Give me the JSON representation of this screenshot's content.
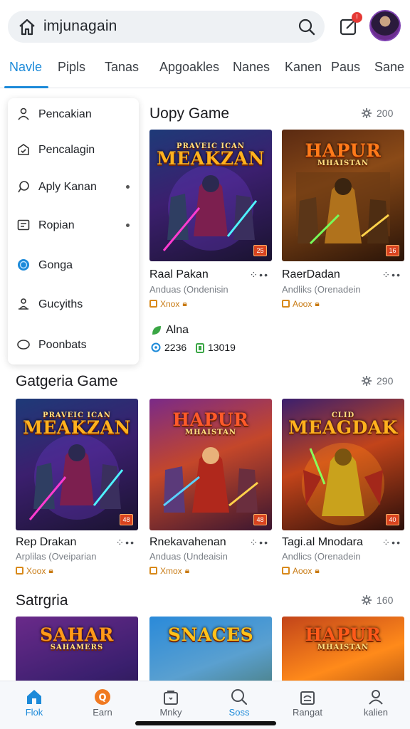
{
  "search": {
    "query": "imjunagain"
  },
  "notifications": {
    "badge": "!"
  },
  "tabs": [
    {
      "label": "Navle"
    },
    {
      "label": "Pipls"
    },
    {
      "label": "Tanas"
    },
    {
      "label": "Apgoakles"
    },
    {
      "label": "Nanes"
    },
    {
      "label": "Kanen"
    },
    {
      "label": "Paus"
    },
    {
      "label": "Sane"
    }
  ],
  "menu": {
    "items": [
      {
        "label": "Pencakian",
        "icon": "person-icon"
      },
      {
        "label": "Pencalagin",
        "icon": "badge-icon"
      },
      {
        "label": "Aply Kanan",
        "icon": "chat-icon"
      },
      {
        "label": "Ropian",
        "icon": "id-card-icon"
      },
      {
        "label": "Gonga",
        "icon": "globe-icon"
      },
      {
        "label": "Gucyiths",
        "icon": "user-stand-icon"
      },
      {
        "label": "Poonbats",
        "icon": "oval-icon"
      }
    ]
  },
  "sections": {
    "featured": {
      "title": "Uopy Game",
      "count": "200",
      "cards": [
        {
          "art_title": "MEAKZAN",
          "art_sub": "PRAVEIC ICAN",
          "rating": "25",
          "name": "Raal Pakan",
          "sub": "Anduas (Ondenisin",
          "tag": "Xnox"
        },
        {
          "art_title": "HAPUR",
          "art_sub": "MHAISTAN",
          "rating": "16",
          "name": "RaerDadan",
          "sub": "Andliks (Orenadein",
          "tag": "Aoox"
        }
      ],
      "stats": {
        "label": "Alna",
        "value_1": "2236",
        "value_2": "13019"
      }
    },
    "category": {
      "title": "Gatgeria Game",
      "count": "290",
      "cards": [
        {
          "art_title": "MEAKZAN",
          "art_sub": "PRAVEIC ICAN",
          "rating": "48",
          "name": "Rep Drakan",
          "sub": "Arplilas (Oveiparian",
          "tag": "Xoox"
        },
        {
          "art_title": "HAPUR",
          "art_sub": "MHAISTAN",
          "rating": "48",
          "name": "Rnekavahenan",
          "sub": "Anduas (Undeaisin",
          "tag": "Xmox"
        },
        {
          "art_title": "MEAGDAK",
          "art_sub": "CLID",
          "rating": "40",
          "name": "Tagi.al Mnodara",
          "sub": "Andlics (Orenadein",
          "tag": "Aoox"
        }
      ]
    },
    "more": {
      "title": "Satrgria",
      "count": "160",
      "cards": [
        {
          "art_title": "SAHAR",
          "art_sub": "SAHAMERS"
        },
        {
          "art_title": "SNACES",
          "art_sub": ""
        },
        {
          "art_title": "HAPUR",
          "art_sub": "MHAISTAN"
        }
      ]
    }
  },
  "bottom_nav": [
    {
      "label": "Flok",
      "icon": "home-icon"
    },
    {
      "label": "Earn",
      "icon": "coin-icon"
    },
    {
      "label": "Mnky",
      "icon": "bag-icon"
    },
    {
      "label": "Soss",
      "icon": "search-icon"
    },
    {
      "label": "Rangat",
      "icon": "store-icon"
    },
    {
      "label": "kalien",
      "icon": "profile-icon"
    }
  ],
  "colors": {
    "accent": "#1c8ad9",
    "badge": "#e53935",
    "tag": "#c87a12"
  }
}
